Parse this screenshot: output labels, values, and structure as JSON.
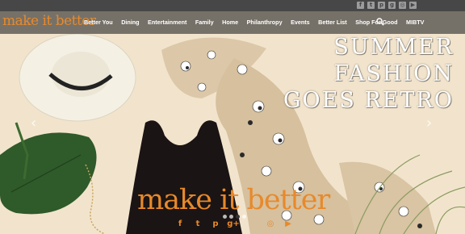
{
  "header": {
    "logo_text": "make it better",
    "nav": [
      "Better You",
      "Dining",
      "Entertainment",
      "Family",
      "Home",
      "Philanthropy",
      "Events",
      "Better List",
      "Shop For Good",
      "MIBTV"
    ],
    "search_icon": "search-icon",
    "top_social_icons": [
      "facebook-icon",
      "twitter-icon",
      "pinterest-icon",
      "google-plus-icon",
      "instagram-icon",
      "youtube-icon"
    ]
  },
  "hero": {
    "headline_line1": "SUMMER",
    "headline_line2": "FASHION",
    "headline_line3": "GOES RETRO",
    "brand_text": "make it better",
    "prev_arrow": "‹",
    "next_arrow": "›",
    "slide_count": 4,
    "active_slide": 3,
    "social_icons": [
      "facebook-icon",
      "twitter-icon",
      "pinterest-icon",
      "google-plus-icon",
      "instagram-icon",
      "youtube-icon"
    ]
  },
  "colors": {
    "brand_orange": "#e8892a",
    "topbar": "#474747",
    "background": "#f3e6cf"
  }
}
